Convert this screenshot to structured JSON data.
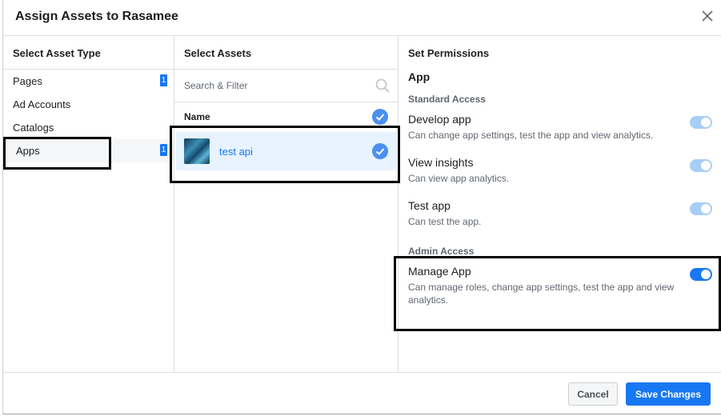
{
  "dialog": {
    "title": "Assign Assets to Rasamee"
  },
  "asset_types": {
    "heading": "Select Asset Type",
    "items": [
      {
        "label": "Pages",
        "badge": "1"
      },
      {
        "label": "Ad Accounts",
        "badge": ""
      },
      {
        "label": "Catalogs",
        "badge": ""
      },
      {
        "label": "Apps",
        "badge": "1",
        "selected": true
      }
    ]
  },
  "assets": {
    "heading": "Select Assets",
    "search_placeholder": "Search & Filter",
    "column_name": "Name",
    "items": [
      {
        "name": "test api",
        "checked": true
      }
    ]
  },
  "permissions": {
    "heading": "Set Permissions",
    "asset_kind": "App",
    "standard_label": "Standard Access",
    "standard": [
      {
        "title": "Develop app",
        "desc": "Can change app settings, test the app and view analytics.",
        "enabled": true,
        "locked": true
      },
      {
        "title": "View insights",
        "desc": "Can view app analytics.",
        "enabled": true,
        "locked": true
      },
      {
        "title": "Test app",
        "desc": "Can test the app.",
        "enabled": true,
        "locked": true
      }
    ],
    "admin_label": "Admin Access",
    "admin": [
      {
        "title": "Manage App",
        "desc": "Can manage roles, change app settings, test the app and view analytics.",
        "enabled": true,
        "locked": false
      }
    ]
  },
  "footer": {
    "cancel_label": "Cancel",
    "save_label": "Save Changes"
  },
  "colors": {
    "accent": "#1877f2",
    "toggle_locked": "#a8cdf7",
    "selected_row": "#e7f3ff"
  },
  "icons": {
    "close": "close-icon",
    "search": "search-icon",
    "check": "check-circle-icon"
  }
}
